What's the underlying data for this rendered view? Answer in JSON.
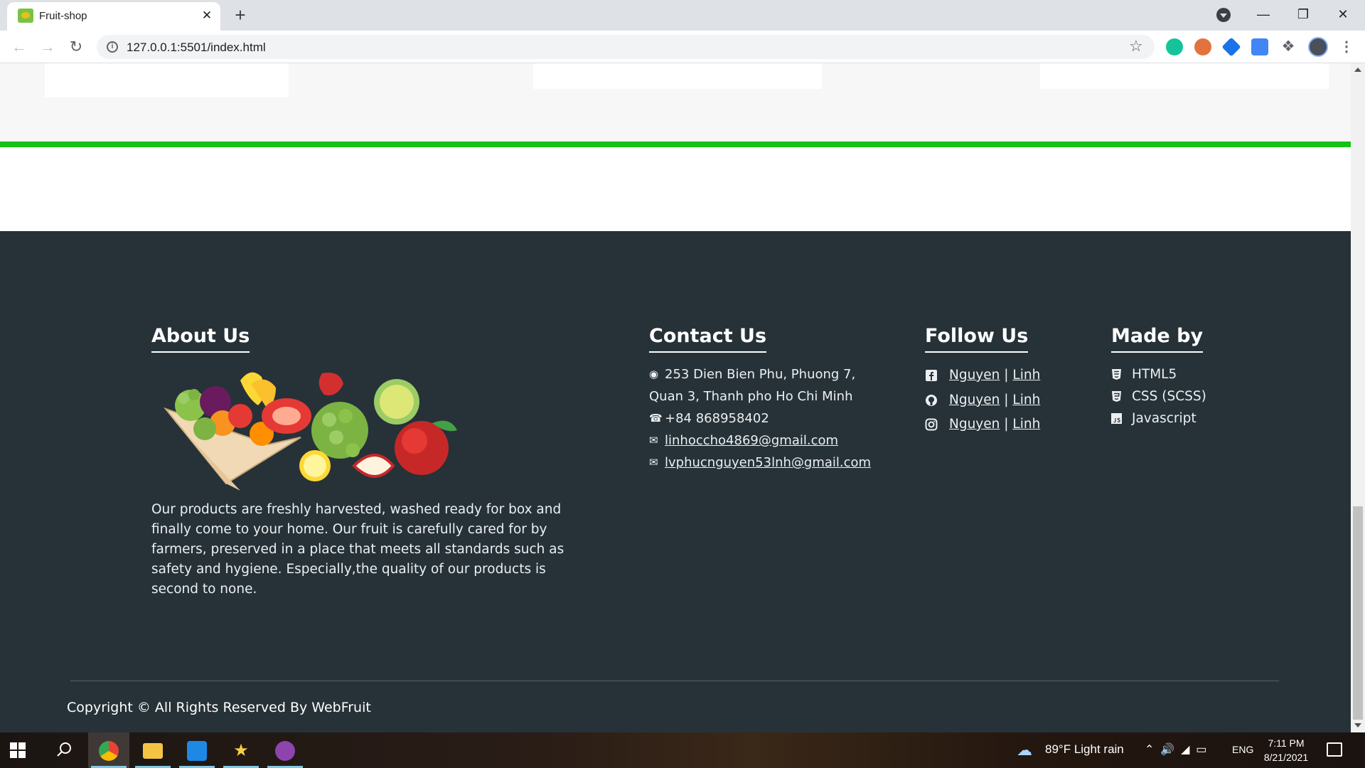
{
  "browser": {
    "tab_title": "Fruit-shop",
    "tab_close": "✕",
    "new_tab": "+",
    "url": "127.0.0.1:5501/index.html"
  },
  "footer": {
    "about": {
      "heading": "About Us",
      "text": "Our products are freshly harvested, washed ready for box and finally come to your home. Our fruit is carefully cared for by farmers, preserved in a place that meets all standards such as safety and hygiene. Especially,the quality of our products is second to none."
    },
    "contact": {
      "heading": "Contact Us",
      "address_line1": "253 Dien Bien Phu, Phuong 7,",
      "address_line2": "Quan 3, Thanh pho Ho Chi Minh",
      "phone": "+84 868958402",
      "email1": "linhoccho4869@gmail.com",
      "email2": "lvphucnguyen53lnh@gmail.com"
    },
    "follow": {
      "heading": "Follow Us",
      "items": [
        {
          "icon": "facebook-icon",
          "first": "Nguyen",
          "sep": "|",
          "second": "Linh"
        },
        {
          "icon": "github-icon",
          "first": "Nguyen",
          "sep": "|",
          "second": "Linh"
        },
        {
          "icon": "instagram-icon",
          "first": "Nguyen",
          "sep": "|",
          "second": "Linh"
        }
      ]
    },
    "made_by": {
      "heading": "Made by",
      "items": [
        {
          "icon": "html5-icon",
          "label": "HTML5"
        },
        {
          "icon": "css3-icon",
          "label": "CSS (SCSS)"
        },
        {
          "icon": "javascript-icon",
          "label": "Javascript"
        }
      ]
    },
    "copyright": "Copyright © All Rights Reserved By WebFruit"
  },
  "taskbar": {
    "weather": "89°F  Light rain",
    "lang": "ENG",
    "time": "7:11 PM",
    "date": "8/21/2021"
  },
  "colors": {
    "accent_green": "#15c215",
    "footer_bg": "#263238"
  }
}
